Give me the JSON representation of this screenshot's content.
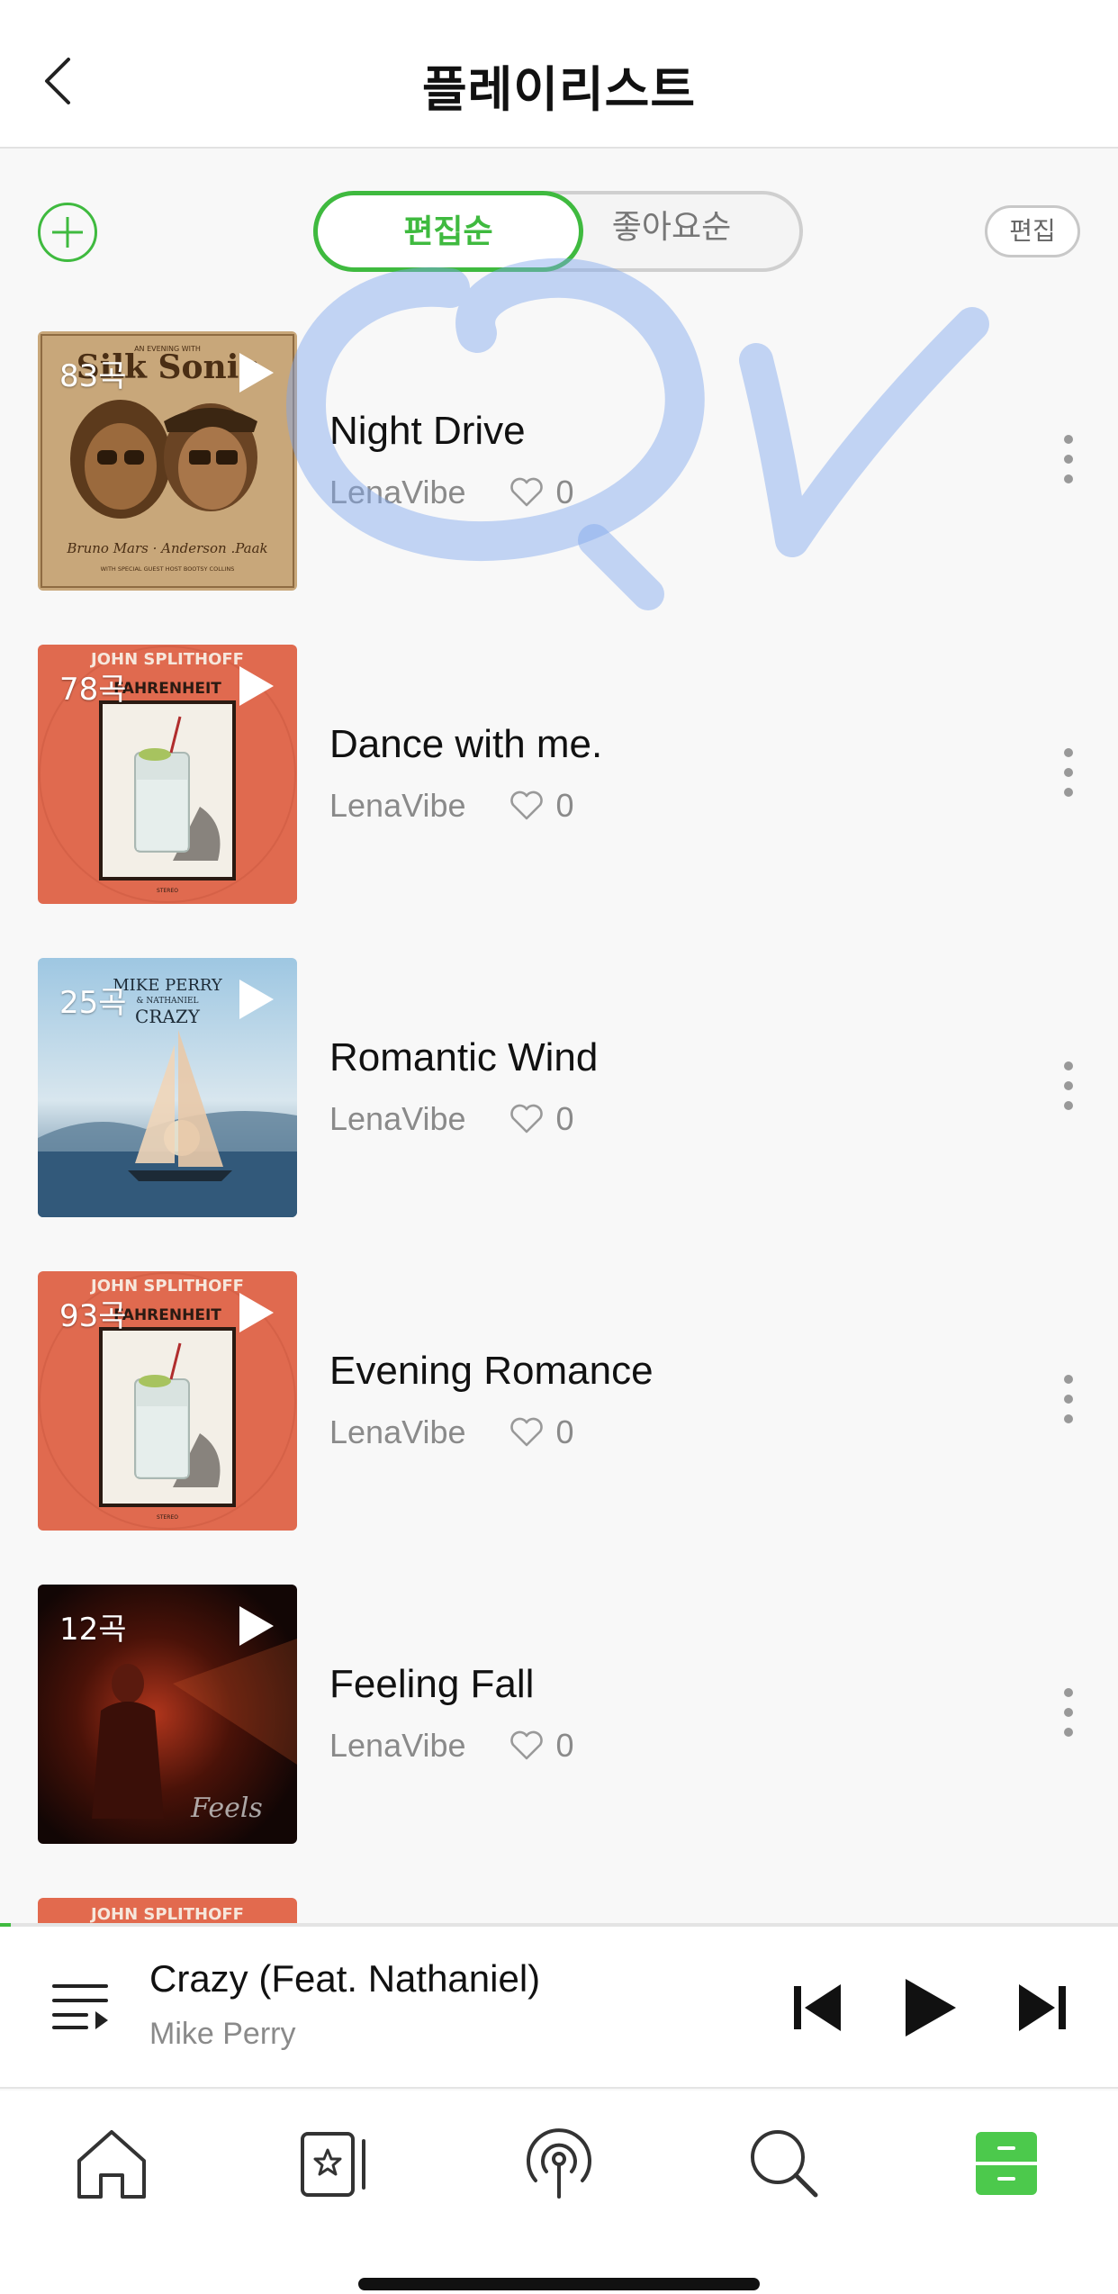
{
  "header": {
    "title": "플레이리스트"
  },
  "toolbar": {
    "sort_options": [
      "편집순",
      "좋아요순"
    ],
    "active_sort": "편집순",
    "edit_label": "편집"
  },
  "playlists": [
    {
      "title": "Night Drive",
      "owner": "LenaVibe",
      "likes": "0",
      "count": "83곡"
    },
    {
      "title": "Dance with me.",
      "owner": "LenaVibe",
      "likes": "0",
      "count": "78곡"
    },
    {
      "title": "Romantic Wind",
      "owner": "LenaVibe",
      "likes": "0",
      "count": "25곡"
    },
    {
      "title": "Evening Romance",
      "owner": "LenaVibe",
      "likes": "0",
      "count": "93곡"
    },
    {
      "title": "Feeling Fall",
      "owner": "LenaVibe",
      "likes": "0",
      "count": "12곡"
    }
  ],
  "covers": {
    "silk_sonic": {
      "top_line": "AN EVENING WITH",
      "name": "Silk Sonic",
      "artists": "Bruno Mars · Anderson .Paak",
      "footer": "WITH SPECIAL GUEST HOST BOOTSY COLLINS"
    },
    "fahrenheit": {
      "artist": "JOHN SPLITHOFF",
      "title": "FAHRENHEIT",
      "footer": "STEREO"
    },
    "crazy": {
      "artist": "MIKE PERRY",
      "feat": "& NATHANIEL",
      "title": "CRAZY"
    },
    "feels": {
      "title": "Feels"
    }
  },
  "now_playing": {
    "title": "Crazy (Feat. Nathaniel)",
    "artist": "Mike Perry",
    "progress": 0.01
  },
  "colors": {
    "accent": "#3fba3f",
    "background": "#f8f8f8",
    "doodle": "#7fa6ee"
  },
  "tabs": [
    {
      "icon": "home-icon"
    },
    {
      "icon": "starred-cards-icon"
    },
    {
      "icon": "podcast-icon"
    },
    {
      "icon": "search-icon"
    },
    {
      "icon": "library-icon",
      "active": true
    }
  ]
}
